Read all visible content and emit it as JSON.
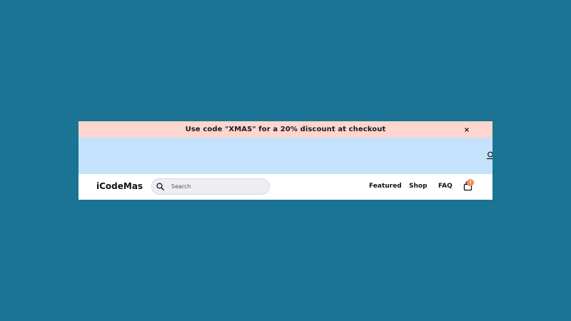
{
  "promo": {
    "message": "Use code \"XMAS\" for a 20% discount at checkout",
    "close_label": "×"
  },
  "header": {
    "logo": "iCodeMas",
    "search": {
      "placeholder": "Search",
      "value": ""
    },
    "nav": [
      {
        "label": "Featured"
      },
      {
        "label": "Shop"
      },
      {
        "label": "FAQ"
      }
    ],
    "cart": {
      "count": "2",
      "icon": "bag-icon"
    }
  },
  "colors": {
    "page_background": "#1b7493",
    "promo_background": "#fdd6cf",
    "hero_background": "#c4e2fb",
    "badge": "#f28a5b"
  }
}
